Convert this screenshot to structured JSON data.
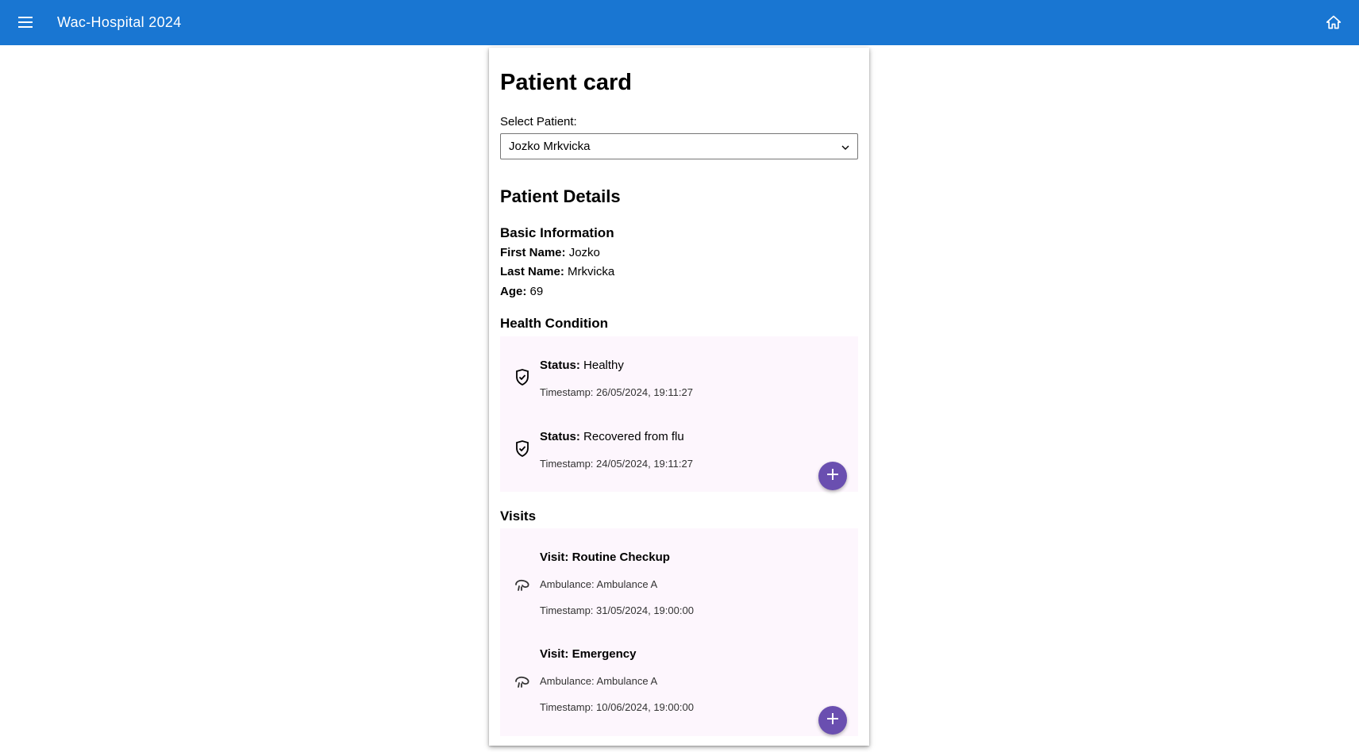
{
  "app": {
    "title": "Wac-Hospital 2024",
    "menu_icon": "menu-icon",
    "home_icon": "home-icon",
    "brand_color": "#1976d2"
  },
  "card": {
    "title": "Patient card",
    "select_label": "Select Patient:",
    "selected_patient": "Jozko Mrkvicka",
    "details_heading": "Patient Details",
    "basic_heading": "Basic Information",
    "first_name_label": "First Name:",
    "first_name": "Jozko",
    "last_name_label": "Last Name:",
    "last_name": "Mrkvicka",
    "age_label": "Age:",
    "age": "69"
  },
  "health": {
    "heading": "Health Condition",
    "status_label": "Status:",
    "items": [
      {
        "status": "Healthy",
        "timestamp": "Timestamp: 26/05/2024, 19:11:27",
        "icon": "shield-check-icon"
      },
      {
        "status": "Recovered from flu",
        "timestamp": "Timestamp: 24/05/2024, 19:11:27",
        "icon": "shield-check-icon"
      }
    ],
    "add_icon": "plus-icon"
  },
  "visits": {
    "heading": "Visits",
    "items": [
      {
        "title": "Visit: Routine Checkup",
        "ambulance": "Ambulance: Ambulance A",
        "timestamp": "Timestamp: 31/05/2024, 19:00:00",
        "icon": "visit-icon"
      },
      {
        "title": "Visit: Emergency",
        "ambulance": "Ambulance: Ambulance A",
        "timestamp": "Timestamp: 10/06/2024, 19:00:00",
        "icon": "visit-icon"
      }
    ],
    "add_icon": "plus-icon"
  },
  "colors": {
    "panel_background": "#fdf6fd",
    "fab": "#6a4fb0"
  }
}
